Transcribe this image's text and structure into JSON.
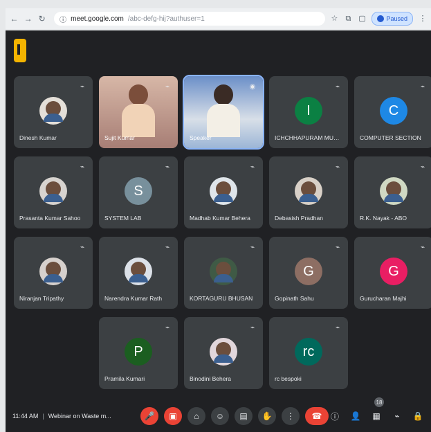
{
  "browser": {
    "omnibox_host": "meet.google.com",
    "omnibox_path": "/abc-defg-hij?authuser=1",
    "profile_label": "Paused",
    "icons": [
      "back-icon",
      "forward-icon",
      "reload-icon",
      "site-info-icon",
      "bookmark-icon",
      "extensions-icon",
      "window-icon",
      "profile-icon",
      "menu-icon"
    ]
  },
  "meet": {
    "participants": [
      {
        "name": "Dinesh Kumar",
        "type": "photo",
        "avatar_bg": "#e4dfd8"
      },
      {
        "name": "Sujit Kumar",
        "type": "video",
        "avatar_bg": "#d7b7a7"
      },
      {
        "name": "Speaker",
        "type": "video-highlight",
        "avatar_bg": "#6b8fc8"
      },
      {
        "name": "ICHCHHAPURAM MUNIC...",
        "type": "initial",
        "initial": "I",
        "avatar_bg": "#0b8043"
      },
      {
        "name": "COMPUTER SECTION",
        "type": "initial",
        "initial": "C",
        "avatar_bg": "#1e88e5"
      },
      {
        "name": "Prasanta Kumar Sahoo",
        "type": "photo",
        "avatar_bg": "#d7d3cf"
      },
      {
        "name": "SYSTEM LAB",
        "type": "initial",
        "initial": "S",
        "avatar_bg": "#78909c"
      },
      {
        "name": "Madhab Kumar Behera",
        "type": "photo",
        "avatar_bg": "#dfe5ea"
      },
      {
        "name": "Debasish Pradhan",
        "type": "photo",
        "avatar_bg": "#d8d0c7"
      },
      {
        "name": "R.K. Nayak - ABO",
        "type": "photo",
        "avatar_bg": "#d0d9c3"
      },
      {
        "name": "Niranjan Tripathy",
        "type": "photo",
        "avatar_bg": "#d7d1cd"
      },
      {
        "name": "Narendra Kumar Rath",
        "type": "photo",
        "avatar_bg": "#dce1e8"
      },
      {
        "name": "KORTAGURU BHUSAN",
        "type": "photo",
        "avatar_bg": "#3f5a45"
      },
      {
        "name": "Gopinath Sahu",
        "type": "initial",
        "initial": "G",
        "avatar_bg": "#8d6e63"
      },
      {
        "name": "Gurucharan Majhi",
        "type": "initial",
        "initial": "G",
        "avatar_bg": "#e91e63"
      },
      {
        "name": "Pramila Kumari",
        "type": "initial",
        "initial": "P",
        "avatar_bg": "#1b5e20"
      },
      {
        "name": "Binodini Behera",
        "type": "photo",
        "avatar_bg": "#e1d6db"
      },
      {
        "name": "rc bespoki",
        "type": "initial",
        "initial": "rc",
        "avatar_bg": "#00695c"
      }
    ],
    "footer": {
      "time": "11:44 AM",
      "title": "Webinar on Waste m..."
    },
    "controls": [
      {
        "name": "mic-button",
        "icon": "mic-off-icon",
        "label": "🎤"
      },
      {
        "name": "camera-button",
        "icon": "camera-off-icon",
        "label": "▣"
      },
      {
        "name": "captions-button",
        "icon": "captions-icon",
        "label": "⌂"
      },
      {
        "name": "emoji-button",
        "icon": "emoji-icon",
        "label": "☺"
      },
      {
        "name": "present-button",
        "icon": "present-icon",
        "label": "▤"
      },
      {
        "name": "hand-button",
        "icon": "hand-icon",
        "label": "✋"
      },
      {
        "name": "more-button",
        "icon": "more-icon",
        "label": "⋮"
      },
      {
        "name": "end-call-button",
        "icon": "phone-end-icon",
        "label": "☎"
      }
    ],
    "right_controls": [
      {
        "name": "info-button",
        "icon": "info-icon",
        "label": "ⓘ"
      },
      {
        "name": "people-button",
        "icon": "people-icon",
        "label": "👤"
      },
      {
        "name": "chat-button",
        "icon": "chat-icon",
        "label": "▦"
      },
      {
        "name": "activities-button",
        "icon": "activities-icon",
        "label": "⌁"
      },
      {
        "name": "host-controls-button",
        "icon": "lock-icon",
        "label": "🔒"
      }
    ],
    "people_badge": "18",
    "colors": {
      "bg": "#202124",
      "tile": "#3c4043",
      "text": "#e8eaed",
      "danger": "#ea4335",
      "accent": "#8ab4f8"
    }
  }
}
